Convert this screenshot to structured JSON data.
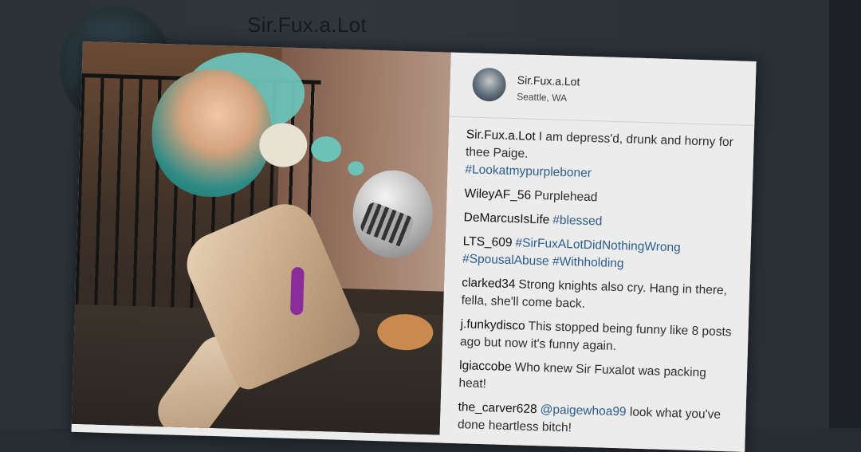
{
  "background": {
    "username": "Sir.Fux.a.Lot"
  },
  "post": {
    "header": {
      "username": "Sir.Fux.a.Lot",
      "location": "Seattle, WA"
    },
    "comments": [
      {
        "user": "Sir.Fux.a.Lot",
        "text": "I am depress'd, drunk and horny for thee Paige.",
        "tags": "#Lookatmypurpleboner"
      },
      {
        "user": "WileyAF_56",
        "text": "Purplehead",
        "tags": ""
      },
      {
        "user": "DeMarcusIsLife",
        "text": "",
        "tags": "#blessed"
      },
      {
        "user": "LTS_609",
        "text": "",
        "tags": "#SirFuxALotDidNothingWrong #SpousalAbuse #Withholding"
      },
      {
        "user": "clarked34",
        "text": "Strong knights also cry. Hang in there, fella, she'll come back.",
        "tags": ""
      },
      {
        "user": "j.funkydisco",
        "text": "This stopped being funny like 8 posts ago but now it's funny again.",
        "tags": ""
      },
      {
        "user": "lgiaccobe",
        "text": "Who knew Sir Fuxalot was packing heat!",
        "tags": ""
      },
      {
        "user": "the_carver628",
        "text": "look what you've done heartless bitch!",
        "mention": "@paigewhoa99"
      }
    ]
  },
  "colors": {
    "hashtag": "#2b5d8f",
    "background": "#2a3238",
    "card": "#ececec"
  }
}
